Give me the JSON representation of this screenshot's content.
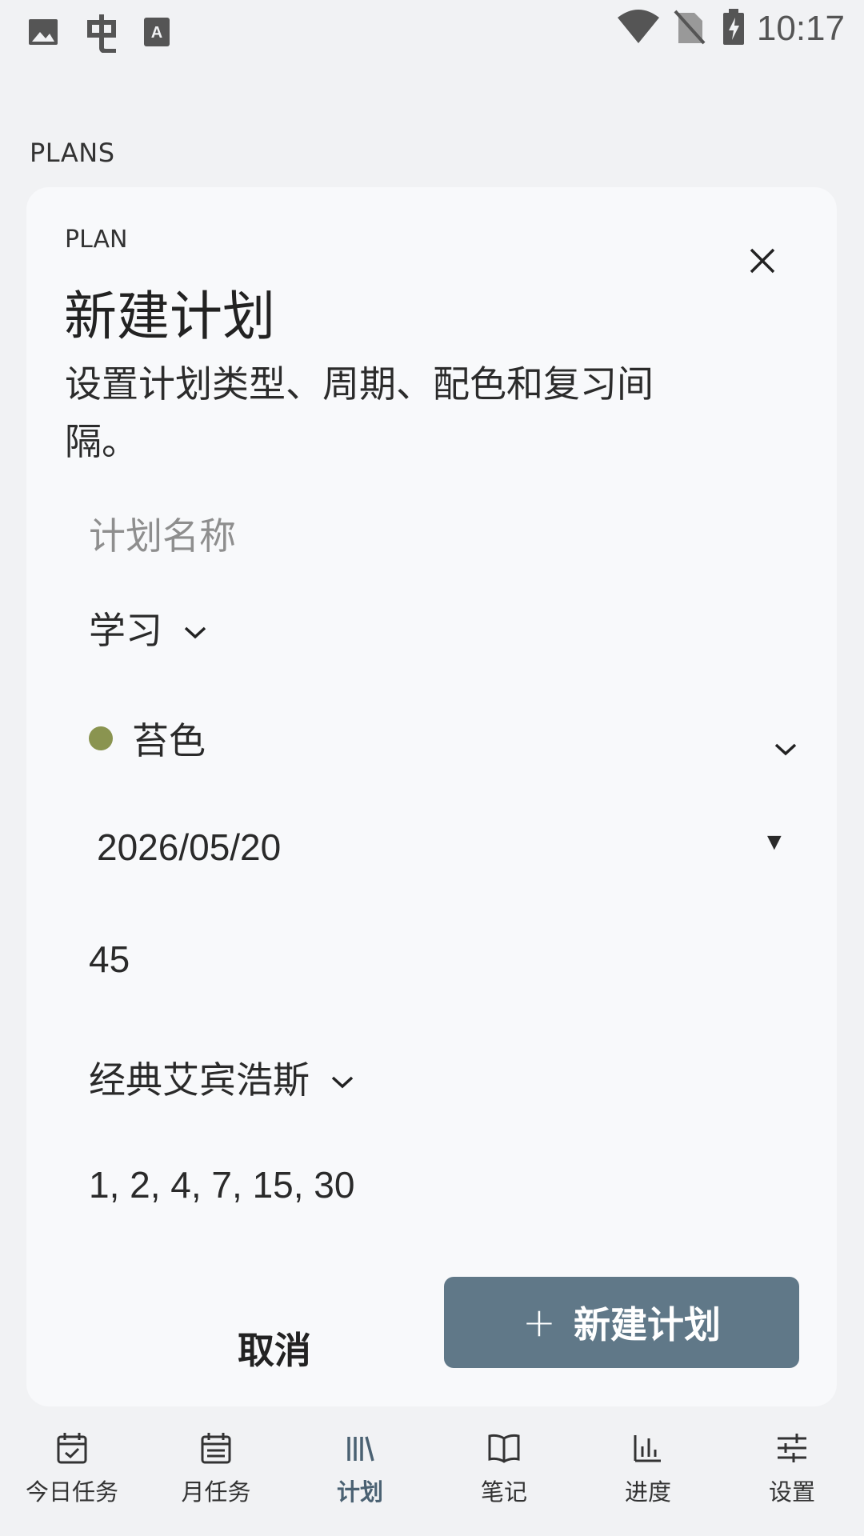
{
  "status_bar": {
    "time": "10:17",
    "left_icons": [
      "image-icon",
      "app-icon",
      "font-icon"
    ],
    "right_icons": [
      "wifi-icon",
      "no-sim-icon",
      "battery-charging-icon"
    ]
  },
  "section_label": "PLANS",
  "dialog": {
    "eyebrow": "PLAN",
    "title": "新建计划",
    "description": "设置计划类型、周期、配色和复习间隔。",
    "name_placeholder": "计划名称",
    "type_value": "学习",
    "color_value": "苔色",
    "color_hex": "#8a9450",
    "date_value": "2026/05/20",
    "minutes_value": "45",
    "curve_value": "经典艾宾浩斯",
    "intervals_value": "1, 2, 4, 7, 15, 30",
    "cancel_label": "取消",
    "create_label": "新建计划"
  },
  "nav": {
    "items": [
      {
        "label": "今日任务",
        "icon": "calendar-check-icon"
      },
      {
        "label": "月任务",
        "icon": "calendar-month-icon"
      },
      {
        "label": "计划",
        "icon": "library-icon"
      },
      {
        "label": "笔记",
        "icon": "book-icon"
      },
      {
        "label": "进度",
        "icon": "bar-chart-icon"
      },
      {
        "label": "设置",
        "icon": "sliders-icon"
      }
    ],
    "active_index": 2
  },
  "colors": {
    "accent": "#607888",
    "nav_active": "#4a6172"
  }
}
